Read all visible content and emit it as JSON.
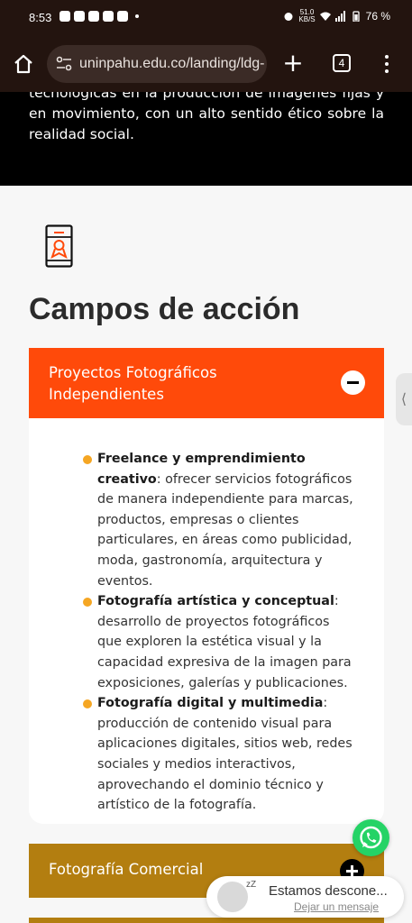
{
  "status_bar": {
    "time": "8:53",
    "net_speed_value": "51.0",
    "net_speed_unit": "KB/S",
    "battery": "76 %"
  },
  "browser": {
    "url": "uninpahu.edu.co/landing/ldg-",
    "tab_count": "4"
  },
  "hero": {
    "text": "tecnológicas en la producción de imágenes fijas y en movimiento, con un alto sentido ético sobre la realidad social."
  },
  "section": {
    "title": "Campos de acción",
    "accordion_open": {
      "label": "Proyectos Fotográficos Independientes",
      "items": [
        {
          "term": "Freelance y emprendimiento creativo",
          "desc": ": ofrecer servicios fotográficos de manera independiente para marcas, productos, empresas o clientes particulares, en áreas como publicidad, moda, gastronomía, arquitectura y eventos."
        },
        {
          "term": "Fotografía artística y conceptual",
          "desc": ": desarrollo de proyectos fotográficos que exploren la estética visual y la capacidad expresiva de la imagen para exposiciones, galerías y publicaciones."
        },
        {
          "term": "Fotografía digital y multimedia",
          "desc": ": producción de contenido visual para aplicaciones digitales, sitios web, redes sociales y medios interactivos, aprovechando el dominio técnico y artístico de la fotografía."
        }
      ]
    },
    "accordion_closed": {
      "label": "Fotografía Comercial"
    }
  },
  "chat": {
    "status": "Estamos descone...",
    "link": "Dejar un mensaje",
    "zz": "zZ"
  },
  "colors": {
    "browser_bg": "#23140f",
    "accent_orange": "#ff4a0a",
    "accent_gold": "#b37e10",
    "bullet": "#f5a623",
    "whatsapp": "#25d366"
  }
}
